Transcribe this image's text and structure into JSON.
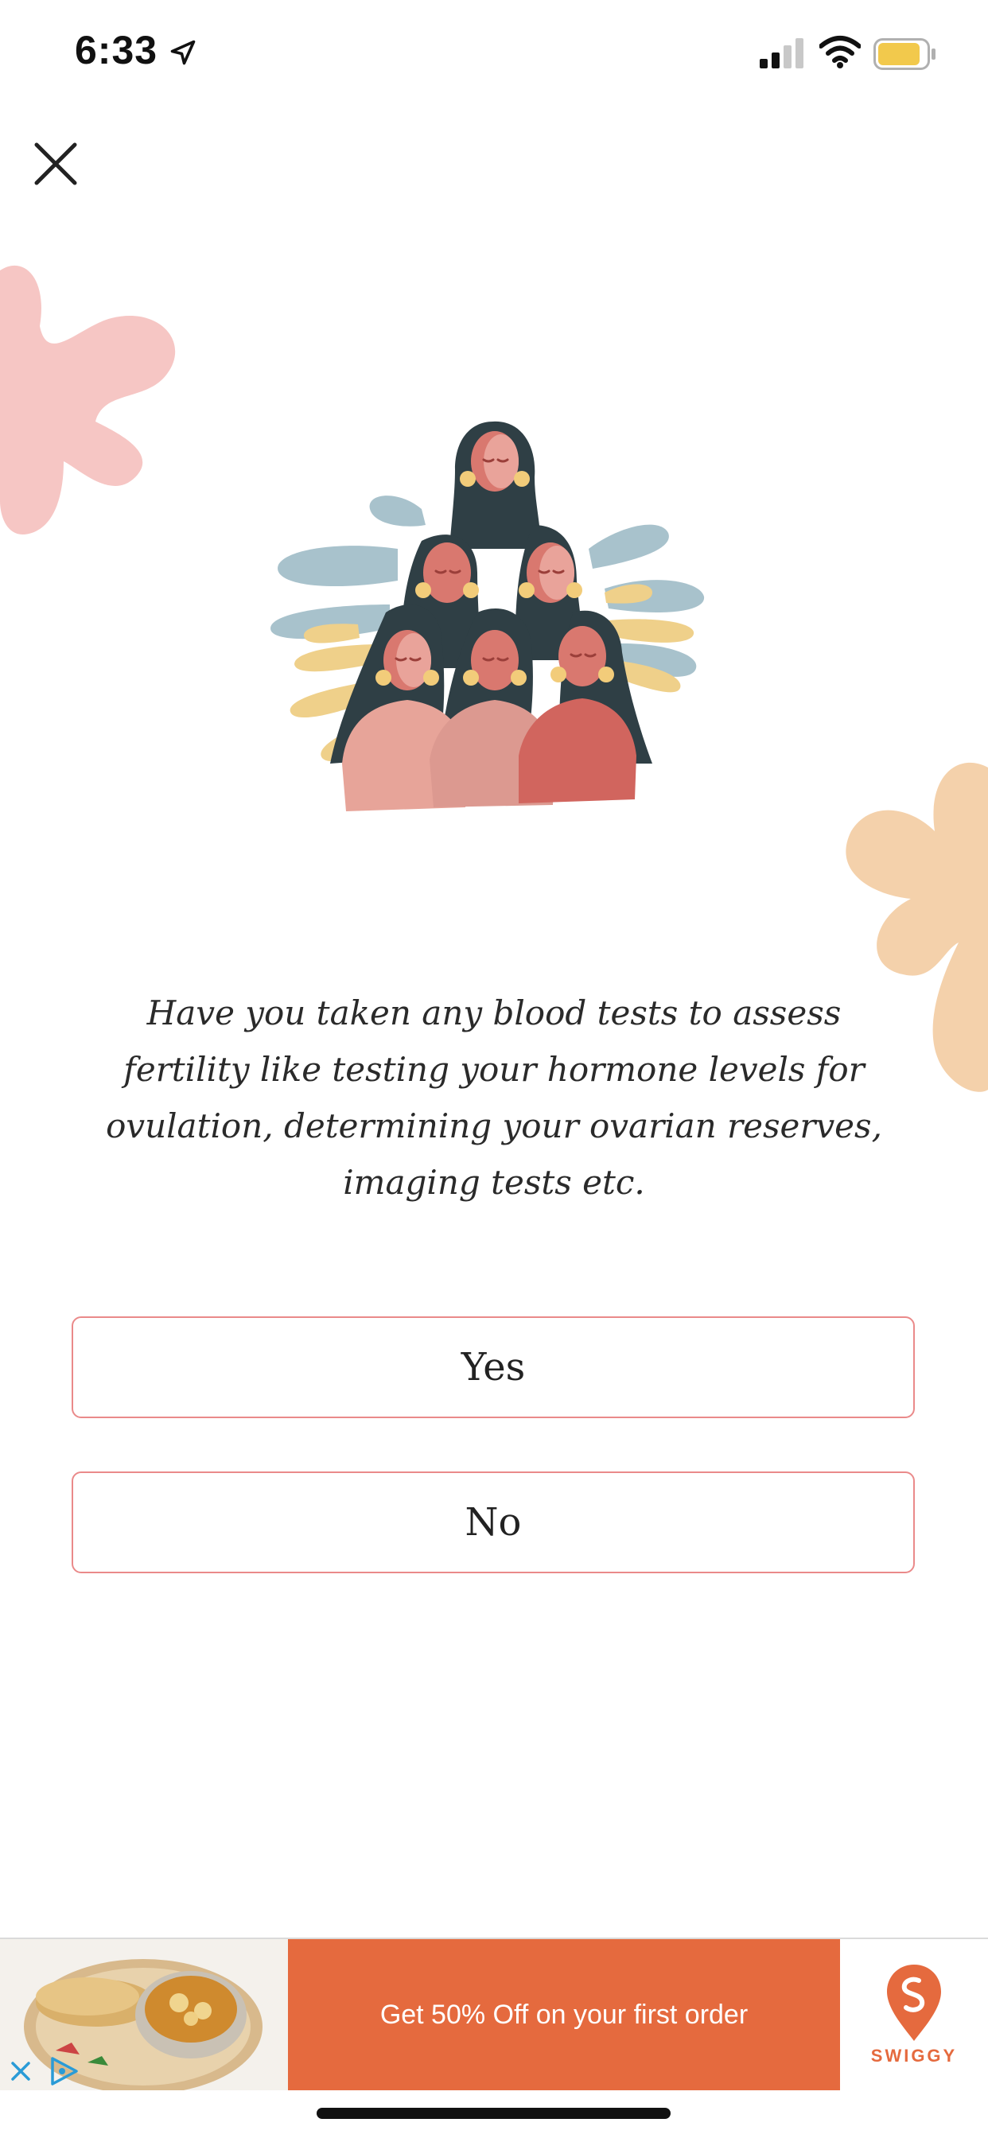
{
  "status_bar": {
    "time": "6:33",
    "icons": [
      "location-arrow-icon",
      "cellular-signal-icon",
      "wifi-icon",
      "battery-icon"
    ],
    "battery_color": "#f2c94c"
  },
  "header": {
    "close_icon": "close-icon"
  },
  "illustration": {
    "icon": "group-of-women-illustration"
  },
  "question": {
    "text": "Have you taken any blood tests to assess fertility like testing your hormone levels for ovulation, determining your ovarian reserves, imaging tests etc."
  },
  "options": [
    {
      "label": "Yes"
    },
    {
      "label": "No"
    }
  ],
  "colors": {
    "option_border": "#ea8a8a",
    "blob_pink": "#f6c6c4",
    "blob_peach": "#f4d1ab",
    "ad_orange": "#e56a3e"
  },
  "ad": {
    "cta_text": "Get 50% Off on your first order",
    "brand": "SWIGGY",
    "close_icon": "ad-close-icon",
    "choices_icon": "ad-choices-icon"
  }
}
